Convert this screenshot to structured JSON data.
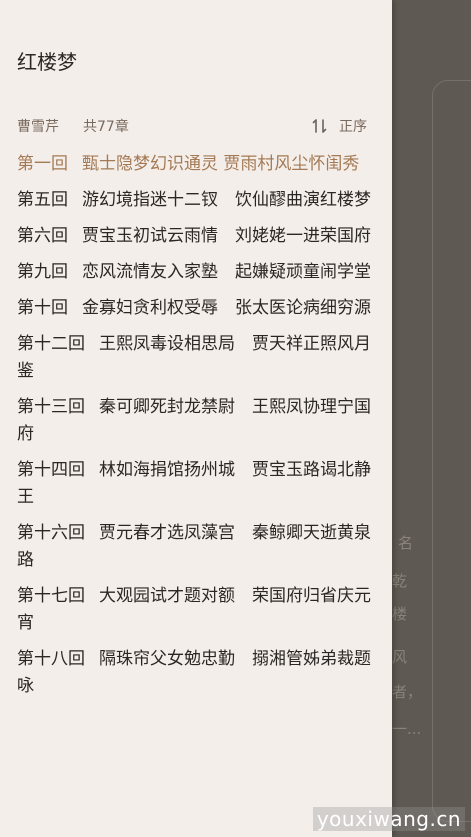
{
  "book": {
    "title": "红楼梦",
    "author": "曹雪芹",
    "chapter_count": "共77章"
  },
  "sort": {
    "label": "正序",
    "icon": "sort-icon"
  },
  "chapters": [
    {
      "num": "第一回",
      "title": "甄士隐梦幻识通灵 贾雨村风尘怀闺秀",
      "active": true
    },
    {
      "num": "第五回",
      "title": "游幻境指迷十二钗　饮仙醪曲演红楼梦"
    },
    {
      "num": "第六回",
      "title": "贾宝玉初试云雨情　刘姥姥一进荣国府"
    },
    {
      "num": "第九回",
      "title": "恋风流情友入家塾　起嫌疑顽童闹学堂"
    },
    {
      "num": "第十回",
      "title": "金寡妇贪利权受辱　张太医论病细穷源"
    },
    {
      "num": "第十二回",
      "title": "王熙凤毒设相思局　贾天祥正照风月鉴"
    },
    {
      "num": "第十三回",
      "title": "秦可卿死封龙禁尉　王熙凤协理宁国府"
    },
    {
      "num": "第十四回",
      "title": "林如海捐馆扬州城　贾宝玉路谒北静王"
    },
    {
      "num": "第十六回",
      "title": "贾元春才选凤藻宫　秦鲸卿天逝黄泉路"
    },
    {
      "num": "第十七回",
      "title": "大观园试才题对额　荣国府归省庆元宵"
    },
    {
      "num": "第十八回",
      "title": "隔珠帘父女勉忠勤　搦湘管姊弟裁题咏"
    }
  ],
  "background_text": [
    "名",
    "乾",
    "楼",
    "风",
    "者，",
    "一..."
  ],
  "watermark": "youxiwang.cn",
  "colors": {
    "drawer_bg": "#f4eeea",
    "active_chapter": "#a47a55",
    "meta_text": "#7a6a5e"
  }
}
